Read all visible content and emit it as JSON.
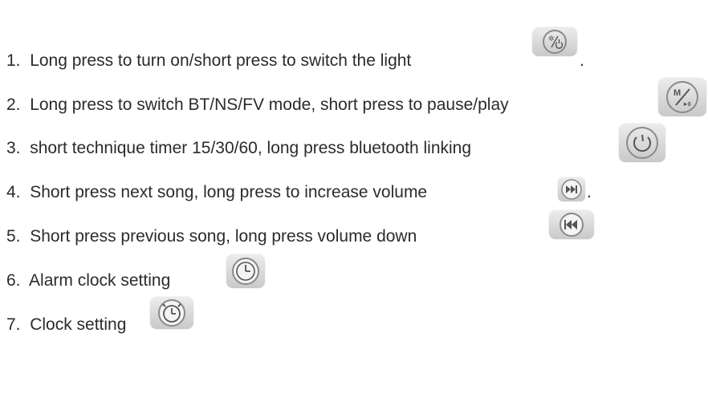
{
  "instructions": [
    {
      "number": "1.",
      "text": "Long press to turn on/short press to switch the light",
      "suffix": ".",
      "icon": "light-power-button-icon"
    },
    {
      "number": "2.",
      "text": "Long press to switch BT/NS/FV mode, short press to pause/play",
      "suffix": "",
      "icon": "mode-play-pause-button-icon"
    },
    {
      "number": "3.",
      "text": "short technique timer 15/30/60, long press bluetooth linking",
      "suffix": "",
      "icon": "timer-button-icon"
    },
    {
      "number": "4.",
      "text": "Short press next song, long press to increase volume",
      "suffix": ".",
      "icon": "next-track-button-icon"
    },
    {
      "number": "5.",
      "text": "Short press previous song, long press volume down",
      "suffix": "",
      "icon": "previous-track-button-icon"
    },
    {
      "number": "6.",
      "text": "Alarm clock setting",
      "suffix": "",
      "icon": "alarm-clock-button-icon"
    },
    {
      "number": "7.",
      "text": "Clock setting",
      "suffix": "",
      "icon": "clock-button-icon"
    }
  ],
  "colors": {
    "text": "#2b2b2b",
    "icon_face": "#d9d9d9",
    "icon_symbol": "#555555"
  }
}
